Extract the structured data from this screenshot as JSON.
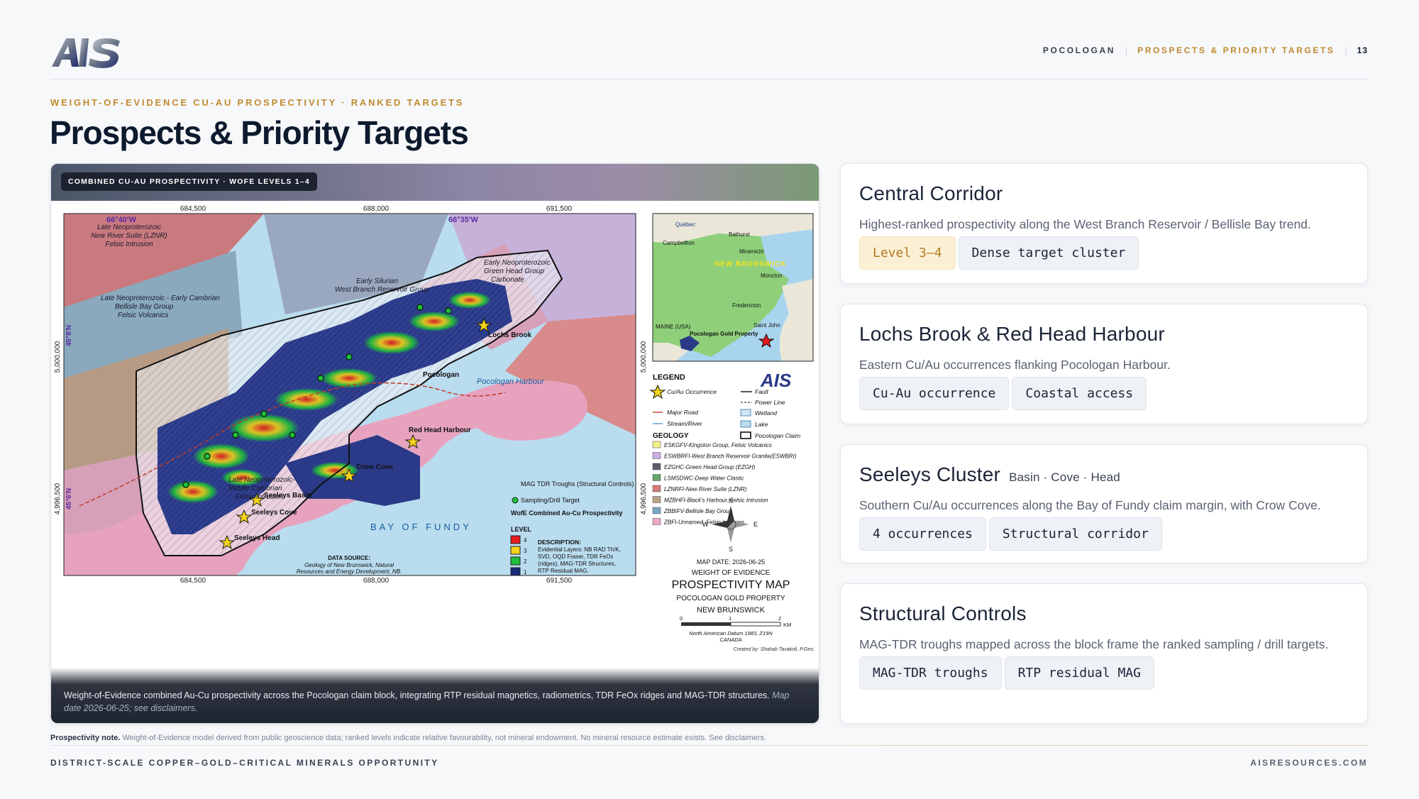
{
  "header": {
    "logo_text": "AIS",
    "crumbs": [
      "POCOLOGAN",
      "PROSPECTS & PRIORITY TARGETS"
    ],
    "page_number": "13"
  },
  "eyebrow": "WEIGHT-OF-EVIDENCE CU-AU PROSPECTIVITY · RANKED TARGETS",
  "title": "Prospects & Priority Targets",
  "map": {
    "badge": "COMBINED CU-AU PROSPECTIVITY · WOFE LEVELS 1–4",
    "x_ticks": [
      "684,500",
      "688,000",
      "691,500"
    ],
    "y_ticks": [
      "5,000,000",
      "4,996,500"
    ],
    "lat_labels": [
      "45°8'N",
      "45°6'N"
    ],
    "lon_labels": [
      "66°40'W",
      "66°35'W"
    ],
    "place_labels": {
      "pocologan": "Pocologan",
      "lochs_brook": "Lochs Brook",
      "red_head_harbour": "Red Head Harbour",
      "crow_cove": "Crow Cove",
      "seeleys_basin": "Seeleys Basin",
      "seeleys_cove": "Seeleys Cove",
      "seeleys_head": "Seeleys Head",
      "pocologan_harbour": "Pocologan Harbour",
      "bay_of_fundy": "BAY OF FUNDY"
    },
    "unit_labels": {
      "lznrfi": "Late Neoproterozoic New River Suite (LZNR) Felsic Intrusion",
      "bellisle": "Late Neoproterozoic - Early Cambrian Bellisle Bay Group Felsic Volcanics",
      "west_branch": "Early Silurian West Branch Reservoir Group Granite",
      "green_head": "Early Neoproterozoic Green Head Group Carbonate",
      "middle_cambrian": "Late Neoproterozoic-Middle Cambrian Felsic Intrusion"
    },
    "inset": {
      "labels": [
        "Québec",
        "NEW BRUNSWICK",
        "Bathurst",
        "Campbellton",
        "Miramichi",
        "Moncton",
        "Fredericton",
        "Saint John",
        "MAINE (USA)",
        "Pocologan Gold Property"
      ]
    },
    "legend": {
      "title": "LEGEND",
      "symbols": [
        "Cu/Au Occurrence",
        "Fault",
        "Power Line",
        "Major Road",
        "Wetland",
        "Stream/River",
        "Lake",
        "Pocologan Claim"
      ],
      "geology_title": "GEOLOGY",
      "geology": [
        {
          "label": "ESKGFV-Kingston Group, Felsic Volcanics",
          "color": "#f2ee8a"
        },
        {
          "label": "ESWBRFI-West Branch Reservoir Granite(ESWBRI)",
          "color": "#c9b0e6"
        },
        {
          "label": "EZGHC-Green Head Group (EZGH)",
          "color": "#5c6068"
        },
        {
          "label": "LSMSDWC-Deep Water Clastic",
          "color": "#6aa56e"
        },
        {
          "label": "LZNRFI-New River Suite (LZNR)",
          "color": "#d77a7a"
        },
        {
          "label": "MZBHFI-Black's Harbour, Felsic Intrusion",
          "color": "#b9a28a"
        },
        {
          "label": "ZBBIFV-Bellisle Bay Group",
          "color": "#78a7c2"
        },
        {
          "label": "ZBFI-Unnamed, Felsic Intrusion",
          "color": "#f0a6c8"
        }
      ]
    },
    "map_legend": {
      "troughs": "MAG TDR Troughs (Structural Controls)",
      "sampling": "Sampling/Drill Target",
      "wofe_title": "WofE Combined Au-Cu Prospectivity",
      "level_title": "LEVEL",
      "levels": [
        {
          "level": "4",
          "color": "#e41a1c"
        },
        {
          "level": "3",
          "color": "#f2d21b"
        },
        {
          "level": "2",
          "color": "#1fbf3a"
        },
        {
          "level": "1",
          "color": "#1a2a7a"
        }
      ],
      "description_title": "DESCRIPTION:",
      "description": [
        "Evidential Layers: NB RAD Th/K,",
        "SVD, OQD Fraser, TDR FeOx",
        "(ridges), MAG-TDR Structures,",
        "RTP Residual MAG."
      ]
    },
    "data_source": [
      "DATA SOURCE:",
      "Geology of New Brunswick, Natural",
      "Resources and Energy Development, NB."
    ],
    "title_block": {
      "map_date": "MAP DATE: 2026-06-25",
      "line1": "WEIGHT OF EVIDENCE",
      "line2": "PROSPECTIVITY MAP",
      "line3": "POCOLOGAN GOLD PROPERTY",
      "line4": "NEW BRUNSWICK",
      "scale": [
        "0",
        "1",
        "2",
        "KM"
      ],
      "datum": "North American Datum 1983, Z19N",
      "country": "CANADA",
      "credit": "Created by: Shahab Tavakoli, P.Geo."
    },
    "caption": "Weight-of-Evidence combined Au-Cu prospectivity across the Pocologan claim block, integrating RTP residual magnetics, radiometrics, TDR FeOx ridges and MAG-TDR structures.",
    "caption_date": "Map date 2026-06-25; see disclaimers."
  },
  "cards": [
    {
      "title": "Central Corridor",
      "subtitle": "",
      "text": "Highest-ranked prospectivity along the West Branch Reservoir / Bellisle Bay trend.",
      "chips": [
        "Level 3–4",
        "Dense target cluster"
      ]
    },
    {
      "title": "Lochs Brook & Red Head Harbour",
      "subtitle": "",
      "text": "Eastern Cu/Au occurrences flanking Pocologan Harbour.",
      "chips": [
        "Cu-Au occurrence",
        "Coastal access"
      ]
    },
    {
      "title": "Seeleys Cluster",
      "subtitle": "Basin · Cove · Head",
      "text": "Southern Cu/Au occurrences along the Bay of Fundy claim margin, with Crow Cove.",
      "chips": [
        "4 occurrences",
        "Structural corridor"
      ]
    },
    {
      "title": "Structural Controls",
      "subtitle": "",
      "text": "MAG-TDR troughs mapped across the block frame the ranked sampling / drill targets.",
      "chips": [
        "MAG-TDR troughs",
        "RTP residual MAG"
      ]
    }
  ],
  "note": {
    "label": "Prospectivity note.",
    "text": "Weight-of-Evidence model derived from public geoscience data; ranked levels indicate relative favourability, not mineral endowment. No mineral resource estimate exists. See disclaimers."
  },
  "footer": {
    "left": "DISTRICT-SCALE COPPER–GOLD–CRITICAL MINERALS OPPORTUNITY",
    "right": "AISRESOURCES.COM"
  }
}
